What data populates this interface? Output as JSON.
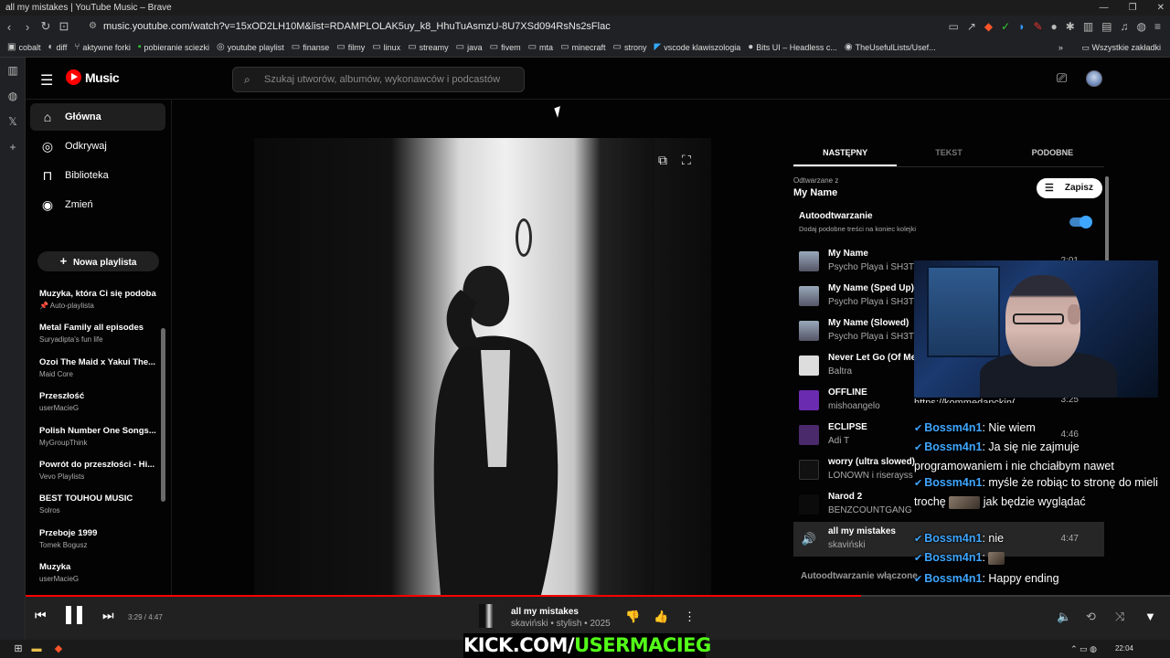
{
  "browser": {
    "window_title": "all my mistakes | YouTube Music – Brave",
    "url": "music.youtube.com/watch?v=15xOD2LH10M&list=RDAMPLOLAK5uy_k8_HhuTuAsmzU-8U7XSd094RsNs2sFlac",
    "bookmarks": [
      "cobalt",
      "diff",
      "aktywne forki",
      "pobieranie sciezki",
      "youtube playlist",
      "finanse",
      "filmy",
      "linux",
      "streamy",
      "java",
      "fivem",
      "mta",
      "minecraft",
      "strony",
      "vscode klawiszologia",
      "Bits UI – Headless c...",
      "TheUsefulLists/Usef..."
    ],
    "bookmarks_other": "Wszystkie zakładki"
  },
  "header": {
    "logo_text": "Music",
    "search_placeholder": "Szukaj utworów, albumów, wykonawców i podcastów"
  },
  "nav": {
    "items": [
      {
        "label": "Główna",
        "icon": "home-icon",
        "selected": true
      },
      {
        "label": "Odkrywaj",
        "icon": "compass-icon",
        "selected": false
      },
      {
        "label": "Biblioteka",
        "icon": "library-icon",
        "selected": false
      },
      {
        "label": "Zmień",
        "icon": "upgrade-icon",
        "selected": false
      }
    ],
    "new_playlist_label": "Nowa playlista",
    "playlists": [
      {
        "title": "Muzyka, która Ci się podoba",
        "sub": "Auto-playlista"
      },
      {
        "title": "Metal Family all episodes",
        "sub": "Suryadipta's fun life"
      },
      {
        "title": "Ozoi The Maid x Yakui The...",
        "sub": "Maid Core"
      },
      {
        "title": "Przeszłość",
        "sub": "userMacieG"
      },
      {
        "title": "Polish Number One Songs...",
        "sub": "MyGroupThink"
      },
      {
        "title": "Powrót do przeszłości - Hi...",
        "sub": "Vevo Playlists"
      },
      {
        "title": "BEST TOUHOU MUSIC",
        "sub": "Solros"
      },
      {
        "title": "Przeboje 1999",
        "sub": "Tomek Bogusz"
      },
      {
        "title": "Muzyka",
        "sub": "userMacieG"
      }
    ]
  },
  "panel": {
    "tabs": [
      "NASTĘPNY",
      "TEKST",
      "PODOBNE"
    ],
    "active_tab": "NASTĘPNY",
    "playing_from_label": "Odtwarzane z",
    "playing_from_name": "My Name",
    "save_label": "Zapisz",
    "autoplay_label": "Autoodtwarzanie",
    "autoplay_desc": "Dodaj podobne treści na koniec kolejki",
    "autoplay_on": true,
    "queue": [
      {
        "title": "My Name",
        "artist": "Psycho Playa i SH3T",
        "duration": "2:01"
      },
      {
        "title": "My Name (Sped Up)",
        "artist": "Psycho Playa i SH3T",
        "duration": ""
      },
      {
        "title": "My Name (Slowed)",
        "artist": "Psycho Playa i SH3T",
        "duration": ""
      },
      {
        "title": "Never Let Go (Of Me",
        "artist": "Baltra",
        "duration": ""
      },
      {
        "title": "OFFLINE",
        "artist": "mishoangelo",
        "duration": "3:25"
      },
      {
        "title": "ECLIPSE",
        "artist": "Adi T",
        "duration": "4:46"
      },
      {
        "title": "worry (ultra slowed)",
        "artist": "LONOWN i riserayss",
        "duration": ""
      },
      {
        "title": "Narod 2",
        "artist": "BENZCOUNTGANG",
        "duration": ""
      },
      {
        "title": "all my mistakes",
        "artist": "skaviński",
        "duration": "4:47",
        "current": true
      }
    ],
    "autoplay_footer": "Autoodtwarzanie włączone"
  },
  "chat": {
    "partial_line": "https://kommedanckin(",
    "messages": [
      {
        "user": "Bossm4n1",
        "text": ": Nie wiem"
      },
      {
        "user": "Bossm4n1",
        "text": ": Ja się nie zajmuje programowaniem i nie chciałbym nawet"
      },
      {
        "user": "Bossm4n1",
        "text": ": myśle że robiąc to stronę do mieli trochę",
        "tail": "jak będzie wyglądać"
      },
      {
        "user": "Bossm4n1",
        "text": ": nie"
      },
      {
        "user": "Bossm4n1",
        "text": ":"
      },
      {
        "user": "Bossm4n1",
        "text": ": Happy ending"
      }
    ]
  },
  "player": {
    "time": "3:29 / 4:47",
    "progress_fraction": 0.73,
    "track_title": "all my mistakes",
    "track_meta": "skaviński • stylish • 2025"
  },
  "overlay": {
    "kick_prefix": "KICK.COM/",
    "kick_channel": "USERMACIEG"
  },
  "taskbar": {
    "time": "22:04"
  }
}
